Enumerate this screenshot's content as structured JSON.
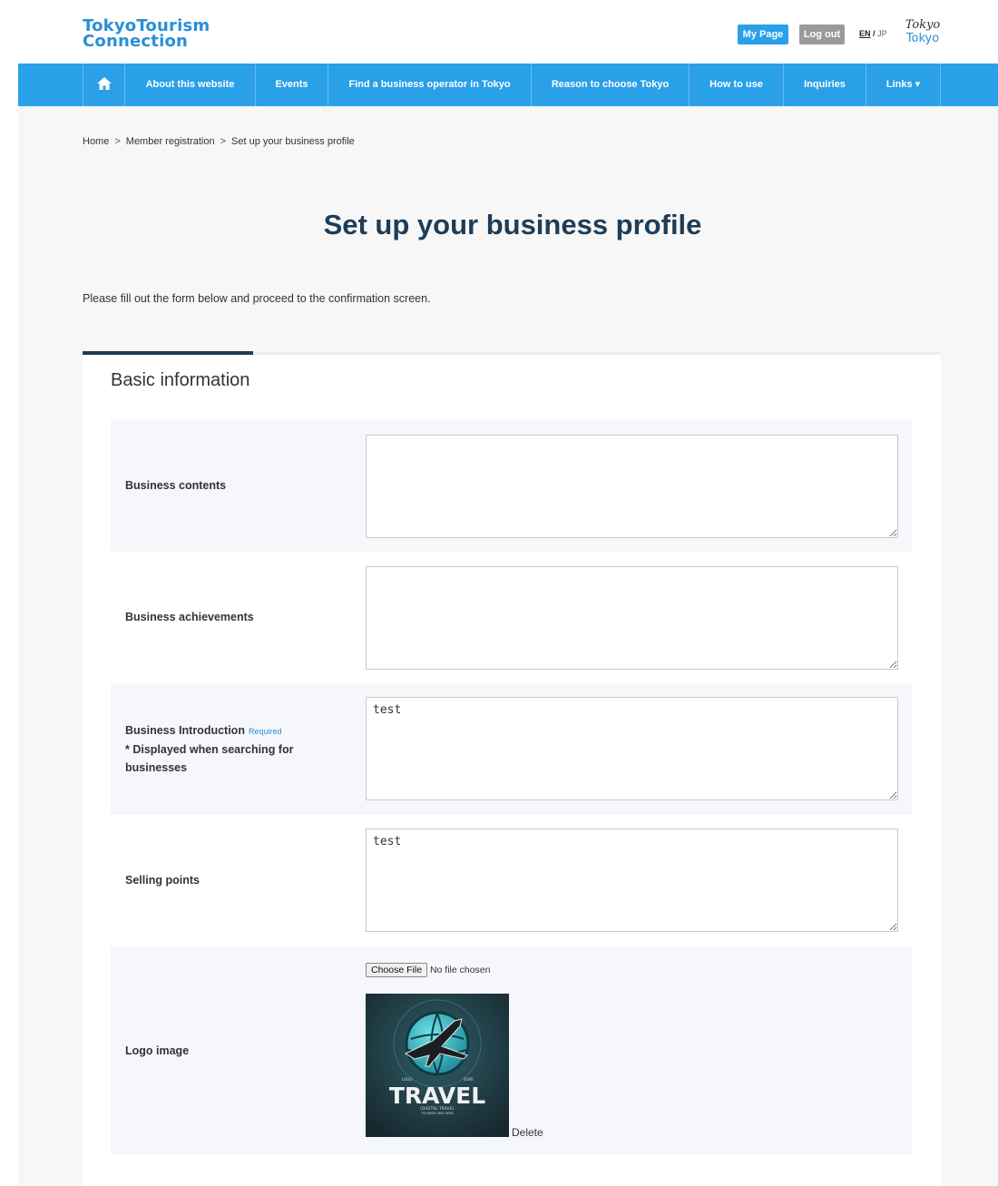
{
  "header": {
    "logo_line1": "TokyoTourism",
    "logo_line2": "Connection",
    "my_page_label": "My Page",
    "logout_label": "Log out",
    "lang_en": "EN",
    "lang_sep": "/",
    "lang_jp": "JP",
    "tokyo_logo_top": "Tokyo",
    "tokyo_logo_bottom": "Tokyo"
  },
  "nav": {
    "home_icon": "home-icon",
    "items": [
      {
        "label": "About this website"
      },
      {
        "label": "Events"
      },
      {
        "label": "Find a business operator in Tokyo"
      },
      {
        "label": "Reason to choose Tokyo"
      },
      {
        "label": "How to use"
      },
      {
        "label": "Inquiries"
      },
      {
        "label": "Links ▾"
      }
    ]
  },
  "breadcrumb": {
    "items": [
      "Home",
      "Member registration",
      "Set up your business profile"
    ],
    "separator": ">"
  },
  "page": {
    "title": "Set up your business profile",
    "intro": "Please fill out the form below and proceed to the confirmation screen."
  },
  "section": {
    "title": "Basic information",
    "fields": [
      {
        "label": "Business contents",
        "value": ""
      },
      {
        "label": "Business achievements",
        "value": ""
      },
      {
        "label": "Business Introduction",
        "required": "Required",
        "note_line1": "* Displayed when searching for",
        "note_line2": "businesses",
        "value": "test"
      },
      {
        "label": "Selling points",
        "value": "test"
      },
      {
        "label": "Logo image",
        "file_button": "Choose File",
        "file_status": "No file chosen",
        "delete_label": "Delete",
        "image_text": "TRAVEL",
        "image_small_left": "LOGO",
        "image_small_right": "EURE",
        "image_tagline1": "(DIGITAL TRAVEL",
        "image_tagline2": "TOURISM AND HERE"
      }
    ]
  },
  "colors": {
    "accent_blue": "#29a0e8",
    "title_navy": "#1d3d58",
    "logout_gray": "#9a9a9a"
  }
}
